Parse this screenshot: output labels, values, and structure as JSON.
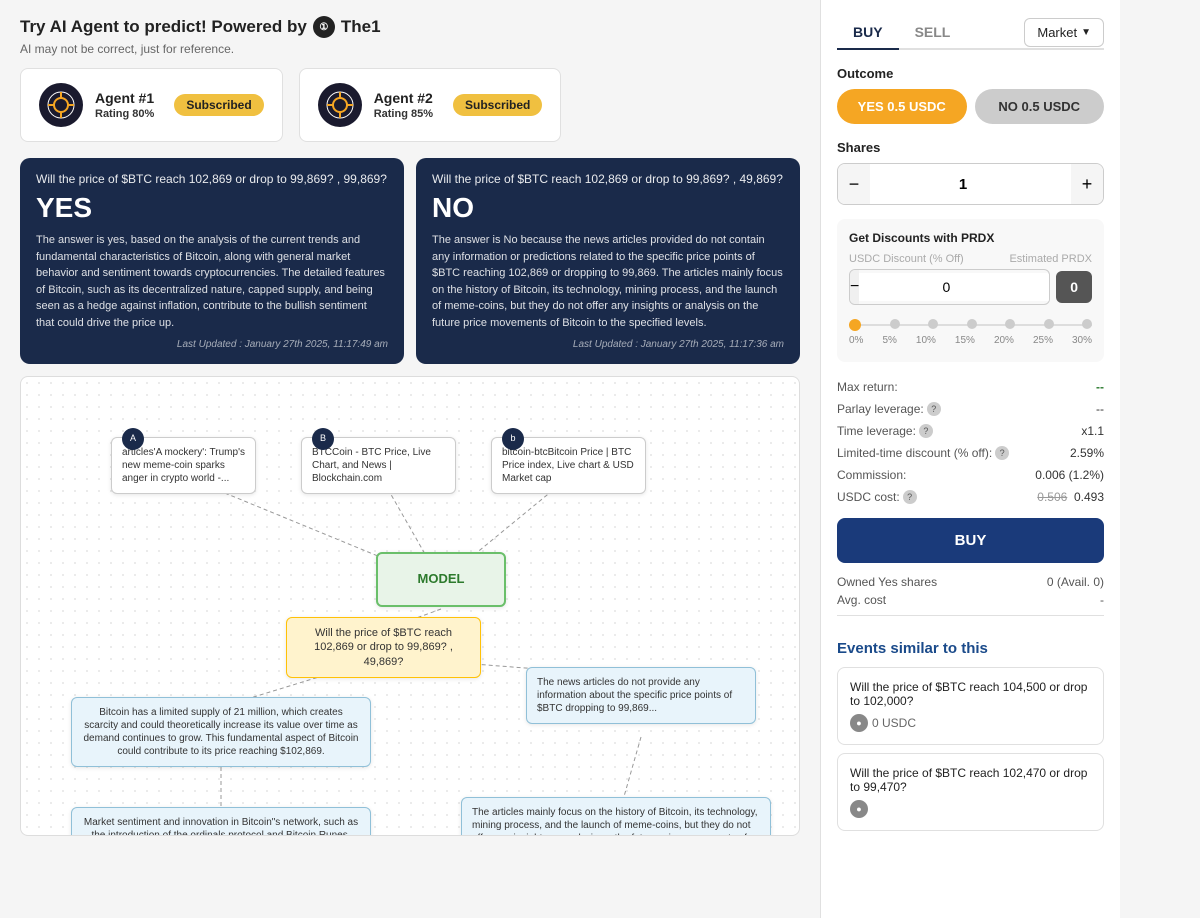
{
  "header": {
    "title": "Try AI Agent to predict! Powered by",
    "logo_text": "①",
    "brand": "The1",
    "subtitle": "AI may not be correct, just for reference."
  },
  "agents": [
    {
      "id": "agent1",
      "name": "Agent #1",
      "rating_label": "Rating",
      "rating_value": "80%",
      "badge": "Subscribed"
    },
    {
      "id": "agent2",
      "name": "Agent #2",
      "rating_label": "Rating",
      "rating_value": "85%",
      "badge": "Subscribed"
    }
  ],
  "answer_cards": [
    {
      "question": "Will the price of $BTC reach 102,869 or drop to 99,869? , 99,869?",
      "verdict": "YES",
      "body": "The answer is yes, based on the analysis of the current trends and fundamental characteristics of Bitcoin, along with general market behavior and sentiment towards cryptocurrencies. The detailed features of Bitcoin, such as its decentralized nature, capped supply, and being seen as a hedge against inflation, contribute to the bullish sentiment that could drive the price up.",
      "updated": "Last Updated : January 27th 2025, 11:17:49 am"
    },
    {
      "question": "Will the price of $BTC reach 102,869 or drop to 99,869? , 49,869?",
      "verdict": "NO",
      "body": "The answer is No because the news articles provided do not contain any information or predictions related to the specific price points of $BTC reaching 102,869 or dropping to 99,869. The articles mainly focus on the history of Bitcoin, its technology, mining process, and the launch of meme-coins, but they do not offer any insights or analysis on the future price movements of Bitcoin to the specified levels.",
      "updated": "Last Updated : January 27th 2025, 11:17:36 am"
    }
  ],
  "diagram": {
    "nodes": [
      {
        "id": "articles",
        "label": "articles'A mockery': Trump's new meme-coin sparks anger in crypto world -..."
      },
      {
        "id": "btccoin",
        "label": "BTCCoin - BTC Price, Live Chart, and News | Blockchain.com"
      },
      {
        "id": "bitcoin_btc",
        "label": "bitcoin-btcBitcoin Price | BTC Price index, Live chart & USD Market cap"
      },
      {
        "id": "model",
        "label": "MODEL"
      },
      {
        "id": "question",
        "label": "Will the price of $BTC reach 102,869 or drop to 99,869? , 49,869?"
      },
      {
        "id": "bitcoin_supply",
        "label": "Bitcoin has a limited supply of 21 million, which creates scarcity and could theoretically increase its value over time as demand continues to grow. This fundamental aspect of Bitcoin could contribute to its price reaching $102,869."
      },
      {
        "id": "news_articles",
        "label": "The news articles do not provide any information about the specific price points of $BTC dropping to 99,869..."
      },
      {
        "id": "market_sentiment",
        "label": "Market sentiment and innovation in Bitcoin\"s network, such as the introduction of the ordinals protocol and Bitcoin Runes, indicate ongoing development and interest. These innovations may attract more users and investors, potentially driving the price up."
      },
      {
        "id": "articles_mainly",
        "label": "The articles mainly focus on the history of Bitcoin, its technology, mining process, and the launch of meme-coins, but they do not offer any insights or analysis on the future price movements of Bitcoin to the specified levels."
      }
    ]
  },
  "sidebar": {
    "tabs": [
      "BUY",
      "SELL"
    ],
    "active_tab": "BUY",
    "market_dropdown_label": "Market",
    "outcome_label": "Outcome",
    "yes_button": "YES 0.5 USDC",
    "no_button": "NO 0.5 USDC",
    "shares_label": "Shares",
    "shares_value": "1",
    "discount_section_title": "Get Discounts with PRDX",
    "usdc_discount_label": "USDC Discount (% Off)",
    "estimated_prdx_label": "Estimated PRDX",
    "discount_value": "0",
    "estimated_prdx_value": "0",
    "slider_options": [
      "0%",
      "5%",
      "10%",
      "15%",
      "20%",
      "25%",
      "30%"
    ],
    "max_return_label": "Max return:",
    "max_return_value": "--",
    "parlay_leverage_label": "Parlay leverage:",
    "parlay_leverage_value": "--",
    "time_leverage_label": "Time leverage:",
    "time_leverage_value": "x1.1",
    "limited_time_discount_label": "Limited-time discount (% off):",
    "limited_time_discount_value": "2.59%",
    "commission_label": "Commission:",
    "commission_value": "0.006 (1.2%)",
    "usdc_cost_label": "USDC cost:",
    "usdc_cost_value_strikethrough": "0.506",
    "usdc_cost_value": "0.493",
    "buy_button_label": "BUY",
    "owned_shares_label": "Owned Yes shares",
    "owned_shares_value": "0 (Avail. 0)",
    "avg_cost_label": "Avg. cost",
    "avg_cost_value": "-"
  },
  "events_similar": {
    "title": "Events similar to this",
    "events": [
      {
        "text": "Will the price of $BTC reach 104,500 or drop to 102,000?",
        "usdc": "0 USDC"
      },
      {
        "text": "Will the price of $BTC reach 102,470 or drop to 99,470?",
        "usdc": ""
      }
    ]
  }
}
